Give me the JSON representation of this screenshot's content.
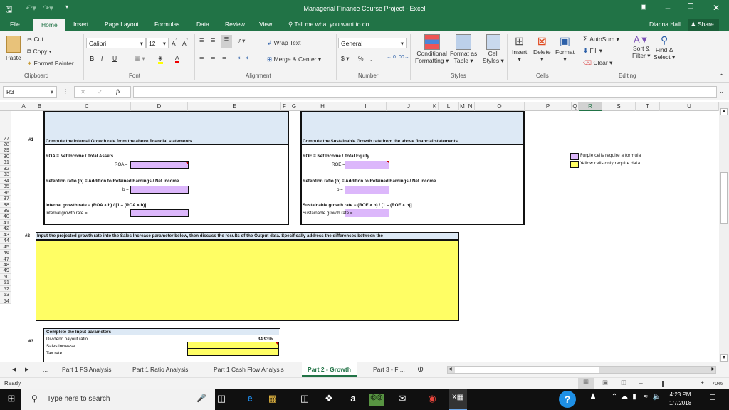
{
  "window": {
    "title": "Managerial Finance Course Project - Excel"
  },
  "quick_access": {
    "save": "save-icon",
    "undo": "undo-icon",
    "redo": "redo-icon",
    "customize": "customize-icon"
  },
  "window_controls": {
    "ribbon_display": "ribbon-display-icon",
    "minimize": "minimize-icon",
    "restore": "restore-icon",
    "close": "close-icon"
  },
  "menu_tabs": [
    "File",
    "Home",
    "Insert",
    "Page Layout",
    "Formulas",
    "Data",
    "Review",
    "View"
  ],
  "tell_me": "Tell me what you want to do...",
  "user": "Dianna Hall",
  "share": "Share",
  "ribbon": {
    "clipboard": {
      "paste": "Paste",
      "cut": "Cut",
      "copy": "Copy",
      "format_painter": "Format Painter",
      "label": "Clipboard"
    },
    "font": {
      "name": "Calibri",
      "size": "12",
      "bold": "B",
      "italic": "I",
      "underline": "U",
      "label": "Font"
    },
    "alignment": {
      "wrap_text": "Wrap Text",
      "merge_center": "Merge & Center",
      "label": "Alignment"
    },
    "number": {
      "format": "General",
      "currency": "$",
      "percent": "%",
      "comma": ",",
      "label": "Number"
    },
    "styles": {
      "conditional": "Conditional",
      "conditional2": "Formatting",
      "format_as": "Format as",
      "format_as2": "Table",
      "cell": "Cell",
      "cell2": "Styles",
      "label": "Styles"
    },
    "cells": {
      "insert": "Insert",
      "delete": "Delete",
      "format": "Format",
      "label": "Cells"
    },
    "editing": {
      "autosum": "AutoSum",
      "fill": "Fill",
      "clear": "Clear",
      "sort": "Sort &",
      "sort2": "Filter",
      "find": "Find &",
      "find2": "Select",
      "label": "Editing"
    }
  },
  "formula_bar": {
    "name_box": "R3",
    "fx": "fx",
    "value": ""
  },
  "columns": [
    "A",
    "B",
    "C",
    "D",
    "E",
    "F",
    "G",
    "H",
    "I",
    "J",
    "K",
    "L",
    "M",
    "N",
    "O",
    "P",
    "Q",
    "R",
    "S",
    "T",
    "U"
  ],
  "selected_column": "R",
  "rows": [
    "27",
    "28",
    "29",
    "30",
    "31",
    "32",
    "33",
    "34",
    "35",
    "36",
    "37",
    "38",
    "39",
    "40",
    "41",
    "42",
    "43",
    "44",
    "45",
    "46",
    "47",
    "48",
    "49",
    "50",
    "51",
    "52",
    "53",
    "54"
  ],
  "section1": {
    "number": "#1",
    "header": "Compute the Internal Growth rate from the above financial statements",
    "roa_formula": "ROA = Net Income / Total Assets",
    "roa_label": "ROA =",
    "retention_formula": "Retention ratio (b) = Addition to Retained Earnings / Net Income",
    "b_label": "b =",
    "igr_formula": "Internal growth rate = (ROA × b) / [1 – (ROA × b)]",
    "igr_label": "Internal growth rate ="
  },
  "section1b": {
    "header": "Compute the Sustainable Growth rate from the above financial statements",
    "roe_formula": "ROE = Net Income / Total Equity",
    "roe_label": "ROE =",
    "retention_formula": "Retention ratio (b) = Addition to Retained Earnings / Net Income",
    "b_label": "b =",
    "sgr_formula": "Sustainable growth rate = (ROE × b) / [1 – (ROE × b)]",
    "sgr_label": "Sustainable growth rate ="
  },
  "legend": {
    "purple": "Purple cells require a formula",
    "yellow": "Yellow cells only require data."
  },
  "section2": {
    "number": "#2",
    "header": "Input the projected growth rate into the Sales Increase parameter below, then discuss the results of the Output data.  Specifically address the differences between the"
  },
  "section3": {
    "number": "#3",
    "header": "Complete the Input parameters",
    "rows": [
      {
        "label": "Dividend payout ratio",
        "value": "34.93%"
      },
      {
        "label": "Sales increase",
        "value": ""
      },
      {
        "label": "Tax rate",
        "value": ""
      }
    ]
  },
  "sheet_tabs": [
    "Part 1 FS Analysis",
    "Part 1 Ratio Analysis",
    "Part 1 Cash Flow Analysis",
    "Part 2 - Growth",
    "Part 3 - F ..."
  ],
  "active_sheet": "Part 2 - Growth",
  "status": {
    "text": "Ready",
    "zoom": "70%"
  },
  "taskbar": {
    "search_placeholder": "Type here to search",
    "time": "4:23 PM",
    "date": "1/7/2018"
  },
  "colors": {
    "excel_green": "#217346",
    "purple_cell": "#dcb7fb",
    "yellow_cell": "#fffe64",
    "header_blue": "#dde9f5"
  }
}
